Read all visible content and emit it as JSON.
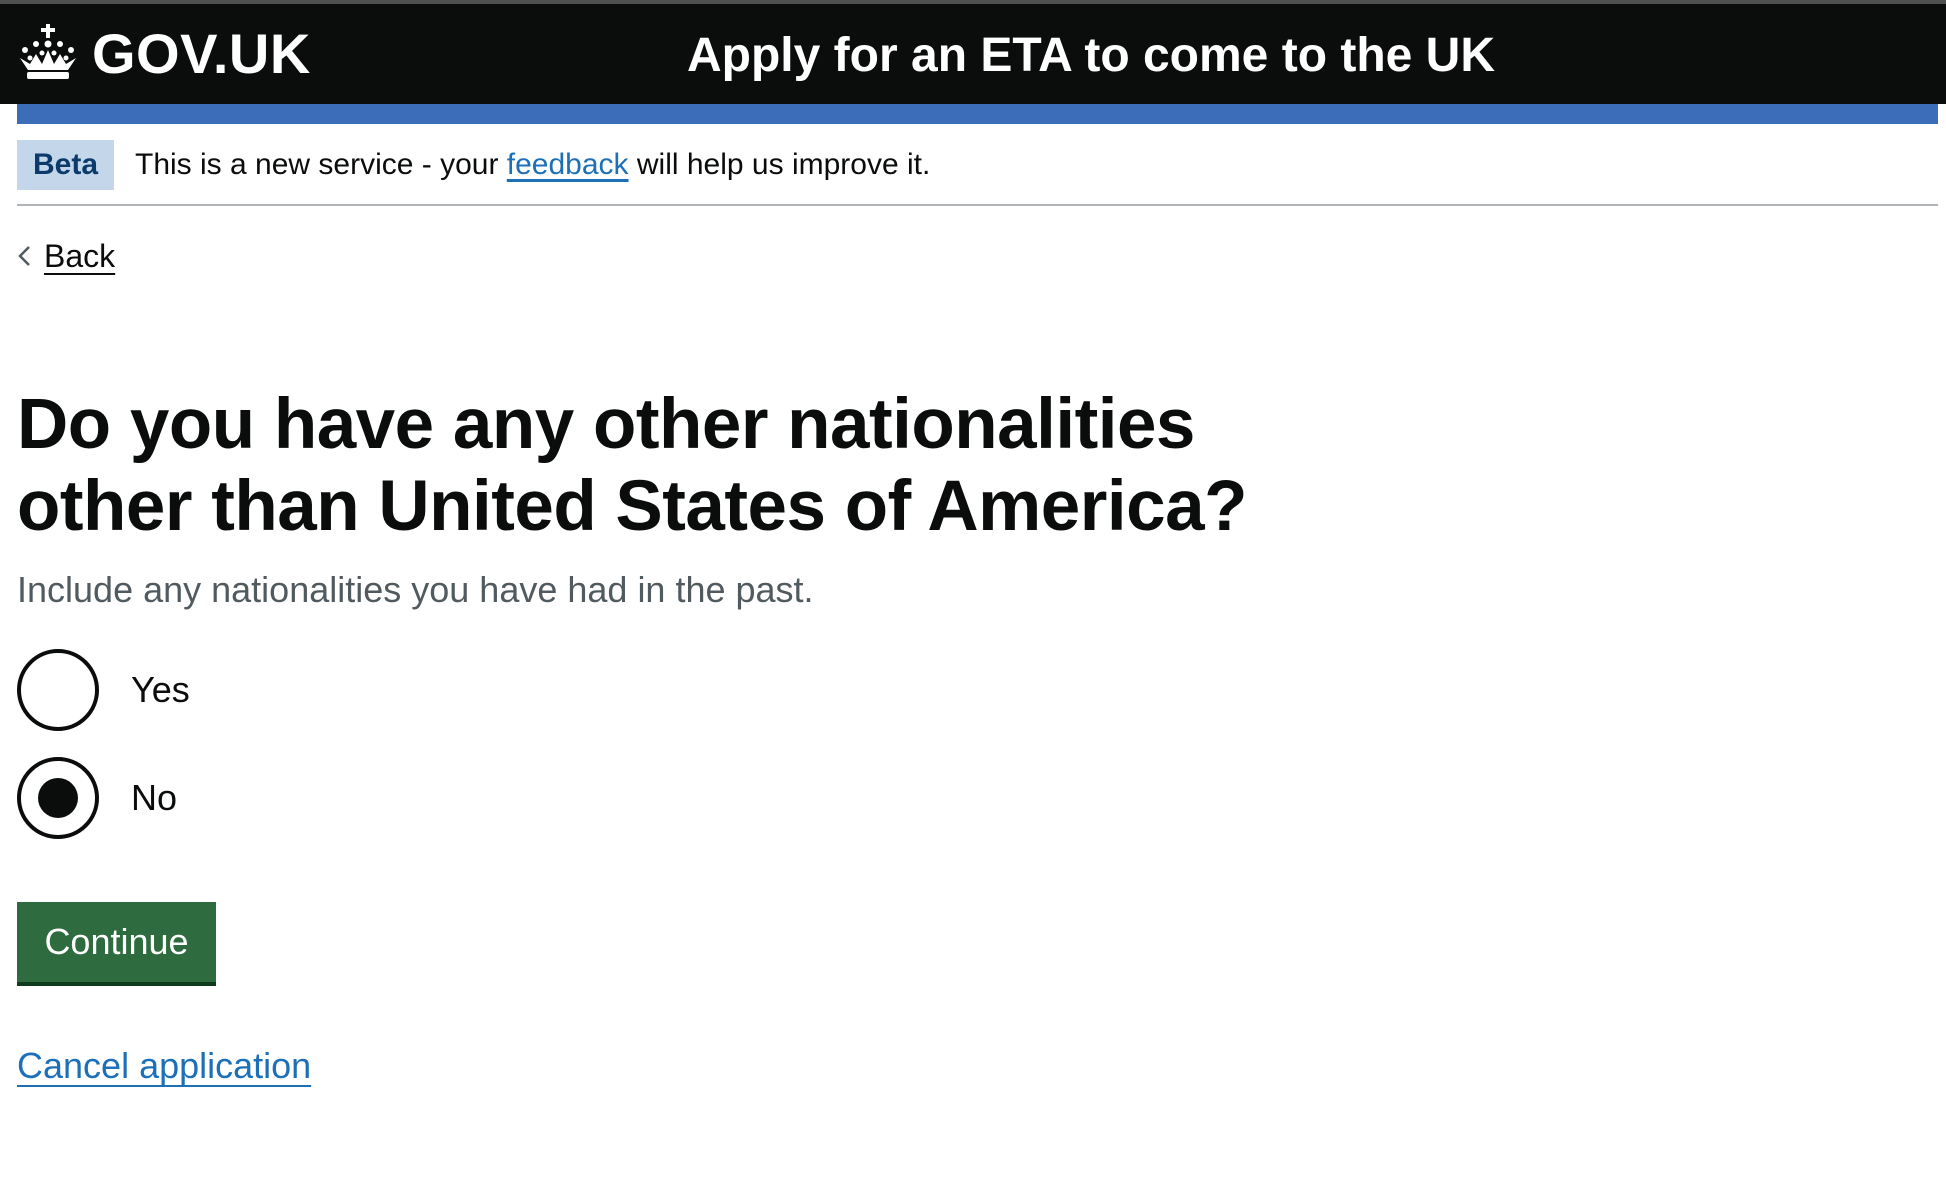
{
  "header": {
    "logo_text": "GOV.UK",
    "service_name": "Apply for an ETA to come to the UK",
    "background_color": "#0b0c0c",
    "accent_bar_color": "#3b6db8"
  },
  "phase_banner": {
    "tag": "Beta",
    "text_before": "This is a new service - your ",
    "link_text": "feedback",
    "text_after": " will help us improve it."
  },
  "back_link": {
    "label": "Back"
  },
  "question": {
    "heading": "Do you have any other nationalities other than United States of America?",
    "hint": "Include any nationalities you have had in the past.",
    "options": [
      {
        "label": "Yes",
        "selected": false
      },
      {
        "label": "No",
        "selected": true
      }
    ]
  },
  "actions": {
    "continue_label": "Continue",
    "continue_color": "#2e6b3e",
    "cancel_label": "Cancel application"
  }
}
